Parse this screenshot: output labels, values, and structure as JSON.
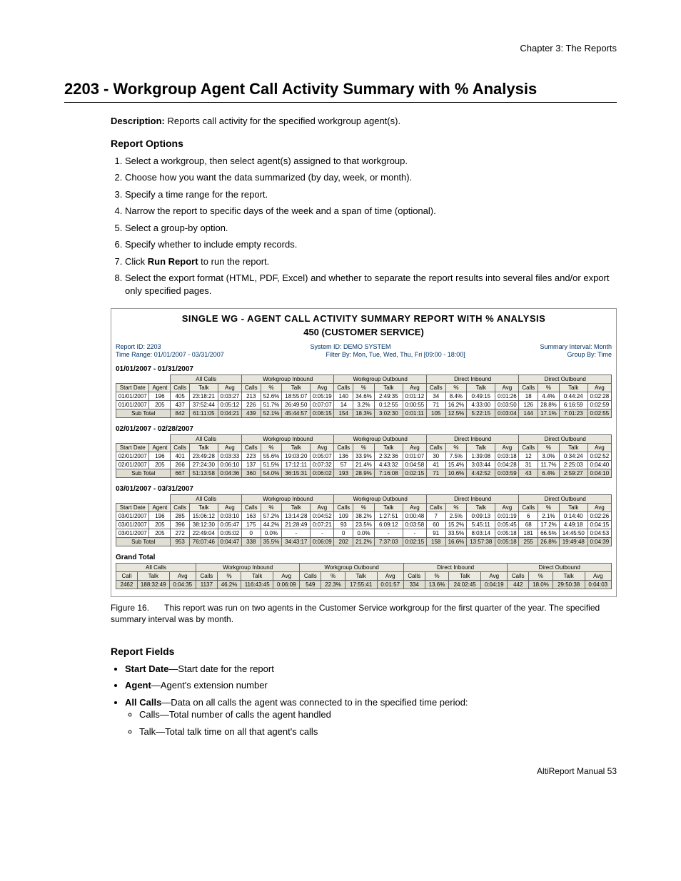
{
  "chapter": "Chapter 3:  The Reports",
  "title": "2203 - Workgroup Agent Call Activity Summary with % Analysis",
  "description_label": "Description:",
  "description_text": "Reports call activity for the specified workgroup agent(s).",
  "report_options_heading": "Report Options",
  "steps": [
    "Select a workgroup, then select agent(s) assigned to that workgroup.",
    "Choose how you want the data summarized (by day, week, or month).",
    "Specify a time range for the report.",
    "Narrow the report to specific days of the week and a span of time (optional).",
    "Select a group-by option.",
    "Specify whether to include empty records.",
    "Click Run Report to run the report.",
    "Select the export format (HTML, PDF, Excel) and whether to separate the report results into several files and/or export only specified pages."
  ],
  "run_report_bold": "Run Report",
  "figure": {
    "title1": "SINGLE WG - AGENT CALL ACTIVITY SUMMARY REPORT WITH % ANALYSIS",
    "title2": "450 (CUSTOMER SERVICE)",
    "meta": {
      "report_id": "Report ID: 2203",
      "system_id": "System ID: DEMO SYSTEM",
      "summary_interval": "Summary Interval: Month",
      "time_range": "Time Range: 01/01/2007 - 03/31/2007",
      "filter_by": "Filter By: Mon, Tue, Wed, Thu, Fri [09:00 - 18:00]",
      "group_by": "Group By: Time"
    },
    "group_headers": [
      "All Calls",
      "Workgroup Inbound",
      "Workgroup Outbound",
      "Direct Inbound",
      "Direct Outbound"
    ],
    "col_headers_first": [
      "Start Date",
      "Agent",
      "Calls",
      "Talk",
      "Avg"
    ],
    "col_headers_group": [
      "Calls",
      "%",
      "Talk",
      "Avg"
    ],
    "periods": [
      {
        "label": "01/01/2007 - 01/31/2007",
        "rows": [
          [
            "01/01/2007",
            "196",
            "405",
            "23:18:21",
            "0:03:27",
            "213",
            "52.6%",
            "18:55:07",
            "0:05:19",
            "140",
            "34.6%",
            "2:49:35",
            "0:01:12",
            "34",
            "8.4%",
            "0:49:15",
            "0:01:26",
            "18",
            "4.4%",
            "0:44:24",
            "0:02:28"
          ],
          [
            "01/01/2007",
            "205",
            "437",
            "37:52:44",
            "0:05:12",
            "226",
            "51.7%",
            "26:49:50",
            "0:07:07",
            "14",
            "3.2%",
            "0:12:55",
            "0:00:55",
            "71",
            "16.2%",
            "4:33:00",
            "0:03:50",
            "126",
            "28.8%",
            "6:16:59",
            "0:02:59"
          ]
        ],
        "subtotal": [
          "Sub Total",
          "",
          "842",
          "61:11:05",
          "0:04:21",
          "439",
          "52.1%",
          "45:44:57",
          "0:06:15",
          "154",
          "18.3%",
          "3:02:30",
          "0:01:11",
          "105",
          "12.5%",
          "5:22:15",
          "0:03:04",
          "144",
          "17.1%",
          "7:01:23",
          "0:02:55"
        ]
      },
      {
        "label": "02/01/2007 - 02/28/2007",
        "rows": [
          [
            "02/01/2007",
            "196",
            "401",
            "23:49:28",
            "0:03:33",
            "223",
            "55.6%",
            "19:03:20",
            "0:05:07",
            "136",
            "33.9%",
            "2:32:36",
            "0:01:07",
            "30",
            "7.5%",
            "1:39:08",
            "0:03:18",
            "12",
            "3.0%",
            "0:34:24",
            "0:02:52"
          ],
          [
            "02/01/2007",
            "205",
            "266",
            "27:24:30",
            "0:06:10",
            "137",
            "51.5%",
            "17:12:11",
            "0:07:32",
            "57",
            "21.4%",
            "4:43:32",
            "0:04:58",
            "41",
            "15.4%",
            "3:03:44",
            "0:04:28",
            "31",
            "11.7%",
            "2:25:03",
            "0:04:40"
          ]
        ],
        "subtotal": [
          "Sub Total",
          "",
          "667",
          "51:13:58",
          "0:04:36",
          "360",
          "54.0%",
          "36:15:31",
          "0:06:02",
          "193",
          "28.9%",
          "7:16:08",
          "0:02:15",
          "71",
          "10.6%",
          "4:42:52",
          "0:03:59",
          "43",
          "6.4%",
          "2:59:27",
          "0:04:10"
        ]
      },
      {
        "label": "03/01/2007 - 03/31/2007",
        "rows": [
          [
            "03/01/2007",
            "196",
            "285",
            "15:06:12",
            "0:03:10",
            "163",
            "57.2%",
            "13:14:28",
            "0:04:52",
            "109",
            "38.2%",
            "1:27:51",
            "0:00:48",
            "7",
            "2.5%",
            "0:09:13",
            "0:01:19",
            "6",
            "2.1%",
            "0:14:40",
            "0:02:26"
          ],
          [
            "03/01/2007",
            "205",
            "396",
            "38:12:30",
            "0:05:47",
            "175",
            "44.2%",
            "21:28:49",
            "0:07:21",
            "93",
            "23.5%",
            "6:09:12",
            "0:03:58",
            "60",
            "15.2%",
            "5:45:11",
            "0:05:45",
            "68",
            "17.2%",
            "4:49:18",
            "0:04:15"
          ],
          [
            "03/01/2007",
            "205",
            "272",
            "22:49:04",
            "0:05:02",
            "0",
            "0.0%",
            "-",
            "-",
            "0",
            "0.0%",
            "-",
            "-",
            "91",
            "33.5%",
            "8:03:14",
            "0:05:18",
            "181",
            "66.5%",
            "14:45:50",
            "0:04:53"
          ]
        ],
        "subtotal": [
          "Sub Total",
          "",
          "953",
          "76:07:46",
          "0:04:47",
          "338",
          "35.5%",
          "34:43:17",
          "0:06:09",
          "202",
          "21.2%",
          "7:37:03",
          "0:02:15",
          "158",
          "16.6%",
          "13:57:38",
          "0:05:18",
          "255",
          "26.8%",
          "19:49:48",
          "0:04:39"
        ]
      }
    ],
    "grand_label": "Grand Total",
    "grand_col_headers_first": [
      "Call",
      "Talk",
      "Avg"
    ],
    "grand_row": [
      "2462",
      "188:32:49",
      "0:04:35",
      "1137",
      "46.2%",
      "116:43:45",
      "0:06:09",
      "549",
      "22.3%",
      "17:55:41",
      "0:01:57",
      "334",
      "13.6%",
      "24:02:45",
      "0:04:19",
      "442",
      "18.0%",
      "29:50:38",
      "0:04:03"
    ]
  },
  "figcaption_label": "Figure 16.",
  "figcaption_text": "This report was run on two agents in the Customer Service workgroup for the first quarter of the year. The specified summary interval was by month.",
  "report_fields_heading": "Report Fields",
  "fields": [
    {
      "bold": "Start Date",
      "rest": "—Start date for the report"
    },
    {
      "bold": "Agent",
      "rest": "—Agent's extension number"
    },
    {
      "bold": "All Calls",
      "rest": "—Data on all calls the agent was connected to in the specified time period:",
      "sub": [
        "Calls—Total number of calls the agent handled",
        "Talk—Total talk time on all that agent's calls"
      ]
    }
  ],
  "footer": "AltiReport Manual   53"
}
